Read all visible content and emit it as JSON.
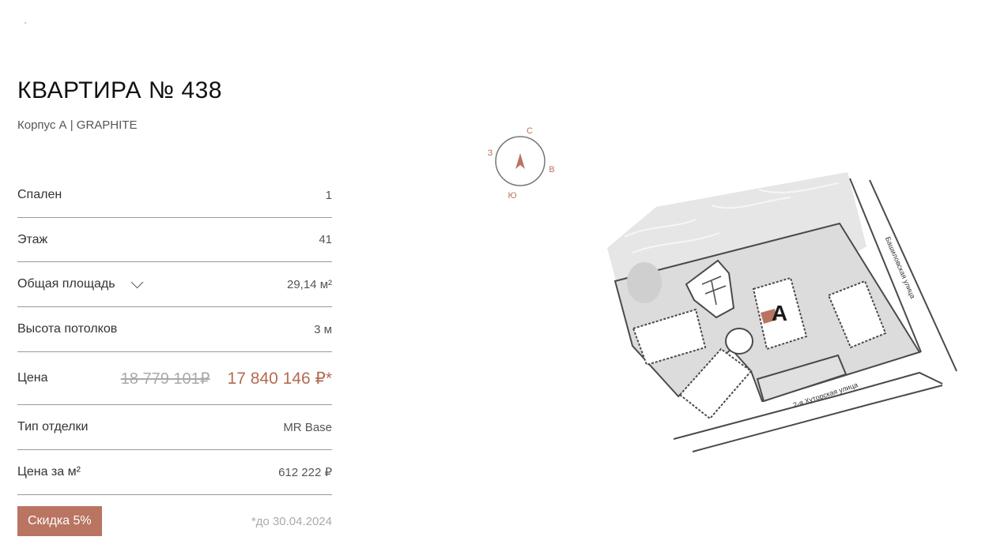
{
  "apartment": {
    "title": "КВАРТИРА № 438",
    "subtitle": "Корпус А | GRAPHITE"
  },
  "specs": {
    "bedrooms": {
      "label": "Спален",
      "value": "1"
    },
    "floor": {
      "label": "Этаж",
      "value": "41"
    },
    "area": {
      "label": "Общая площадь",
      "value": "29,14 м²"
    },
    "ceiling": {
      "label": "Высота потолков",
      "value": "3 м"
    },
    "price": {
      "label": "Цена",
      "old": "18 779 101₽",
      "new": "17 840 146 ₽*"
    },
    "finish": {
      "label": "Тип отделки",
      "value": "MR Base"
    },
    "price_per_m2": {
      "label": "Цена за м²",
      "value": "612 222 ₽"
    }
  },
  "discount": {
    "badge": "Скидка 5%",
    "until": "*до 30.04.2024"
  },
  "map": {
    "compass": {
      "n": "С",
      "e": "В",
      "s": "Ю",
      "w": "З"
    },
    "building_label": "А",
    "street_1": "Башиловская улица",
    "street_2": "2-я Хуторская улица",
    "accent_color": "#b97561"
  }
}
